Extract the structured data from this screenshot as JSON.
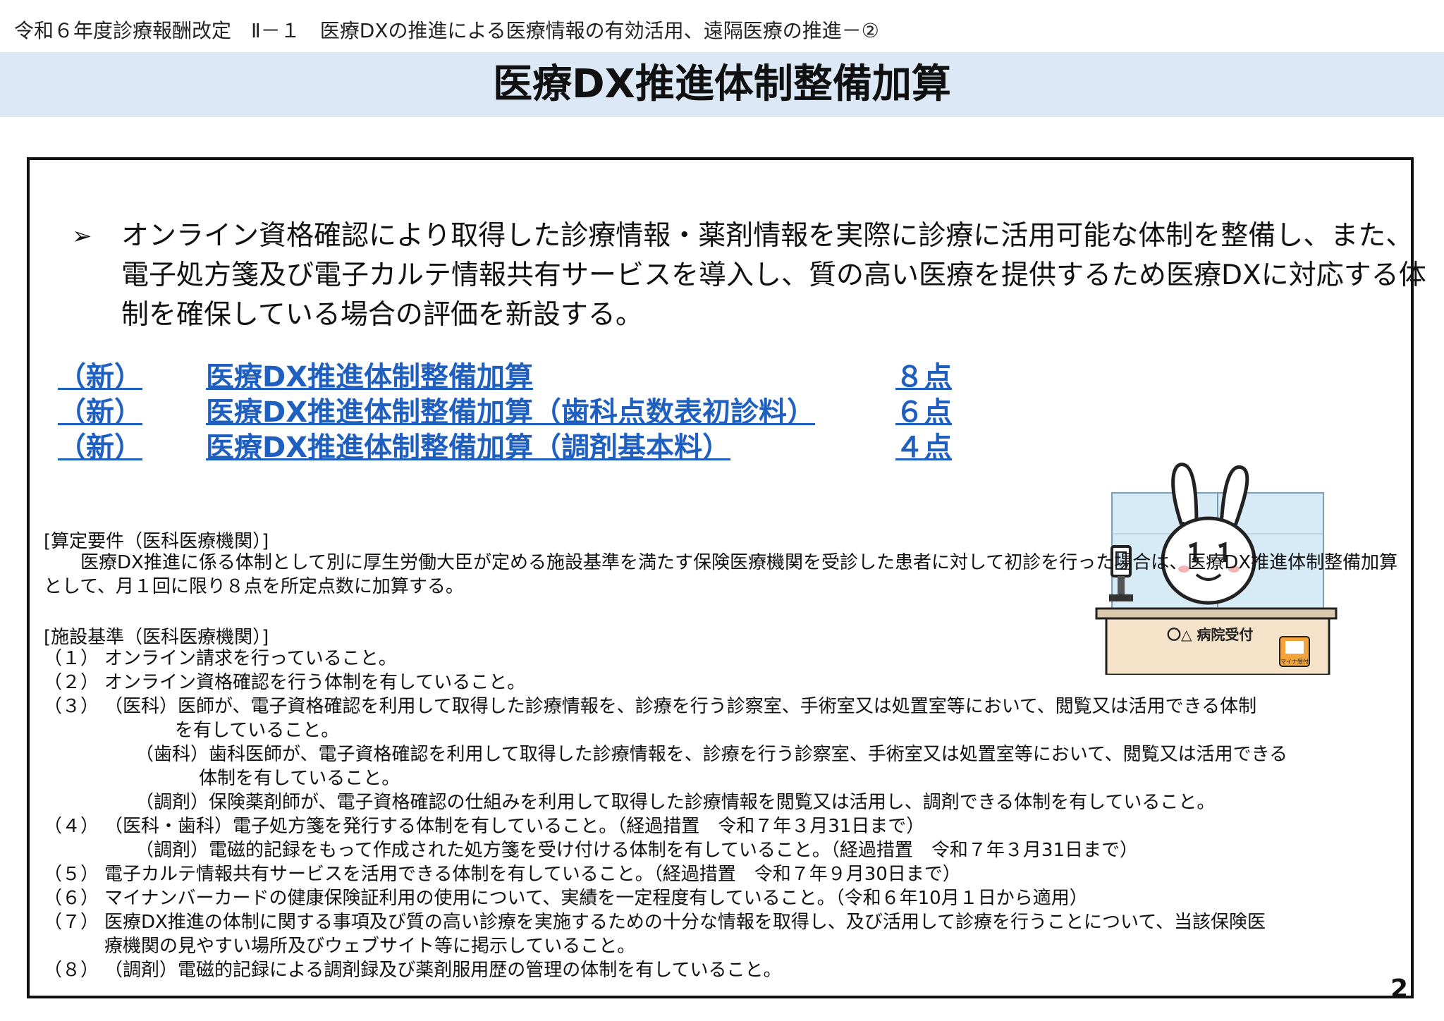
{
  "breadcrumb": "令和６年度診療報酬改定　Ⅱ－１　医療DXの推進による医療情報の有効活用、遠隔医療の推進－②",
  "title": "医療DX推進体制整備加算",
  "lead": "オンライン資格確認により取得した診療情報・薬剤情報を実際に診療に活用可能な体制を整備し、また、電子処方箋及び電子カルテ情報共有サービスを導入し、質の高い医療を提供するため医療DXに対応する体制を確保している場合の評価を新設する。",
  "items": [
    {
      "tag": "（新）",
      "name": "医療DX推進体制整備加算",
      "points": "８点"
    },
    {
      "tag": "（新）",
      "name": "医療DX推進体制整備加算（歯科点数表初診料）",
      "points": "６点"
    },
    {
      "tag": "（新）",
      "name": "医療DX推進体制整備加算（調剤基本料）",
      "points": "４点"
    }
  ],
  "illustration": {
    "sign": "〇△ 病院受付",
    "badge": "マイナ受付",
    "icon": "rabbit-mascot-reception"
  },
  "requirements": {
    "heading": "[算定要件（医科医療機関）]",
    "body": "医療DX推進に係る体制として別に厚生労働大臣が定める施設基準を満たす保険医療機関を受診した患者に対して初診を行った場合は、医療DX推進体制整備加算として、月１回に限り８点を所定点数に加算する。"
  },
  "standards": {
    "heading": "[施設基準（医科医療機関）]",
    "list": [
      {
        "num": "（１）",
        "text": "オンライン請求を行っていること。"
      },
      {
        "num": "（２）",
        "text": "オンライン資格確認を行う体制を有していること。"
      },
      {
        "num": "（３）",
        "text": "（医科）医師が、電子資格確認を利用して取得した診療情報を、診療を行う診察室、手術室又は処置室等において、閲覧又は活用できる体制",
        "cont": "を有していること。"
      },
      {
        "num": "",
        "text": "（歯科）歯科医師が、電子資格確認を利用して取得した診療情報を、診療を行う診察室、手術室又は処置室等において、閲覧又は活用できる",
        "cont": "体制を有していること。"
      },
      {
        "num": "",
        "text": "（調剤）保険薬剤師が、電子資格確認の仕組みを利用して取得した診療情報を閲覧又は活用し、調剤できる体制を有していること。"
      },
      {
        "num": "（４）",
        "text": "（医科・歯科）電子処方箋を発行する体制を有していること。（経過措置　令和７年３月31日まで）"
      },
      {
        "num": "",
        "text": "（調剤）電磁的記録をもって作成された処方箋を受け付ける体制を有していること。（経過措置　令和７年３月31日まで）"
      },
      {
        "num": "（５）",
        "text": "電子カルテ情報共有サービスを活用できる体制を有していること。（経過措置　令和７年９月30日まで）"
      },
      {
        "num": "（６）",
        "text": "マイナンバーカードの健康保険証利用の使用について、実績を一定程度有していること。（令和６年10月１日から適用）"
      },
      {
        "num": "（７）",
        "text": "医療DX推進の体制に関する事項及び質の高い診療を実施するための十分な情報を取得し、及び活用して診療を行うことについて、当該保険医",
        "cont": "療機関の見やすい場所及びウェブサイト等に掲示していること。"
      },
      {
        "num": "（８）",
        "text": "（調剤）電磁的記録による調剤録及び薬剤服用歴の管理の体制を有していること。"
      }
    ]
  },
  "page_number": "2"
}
